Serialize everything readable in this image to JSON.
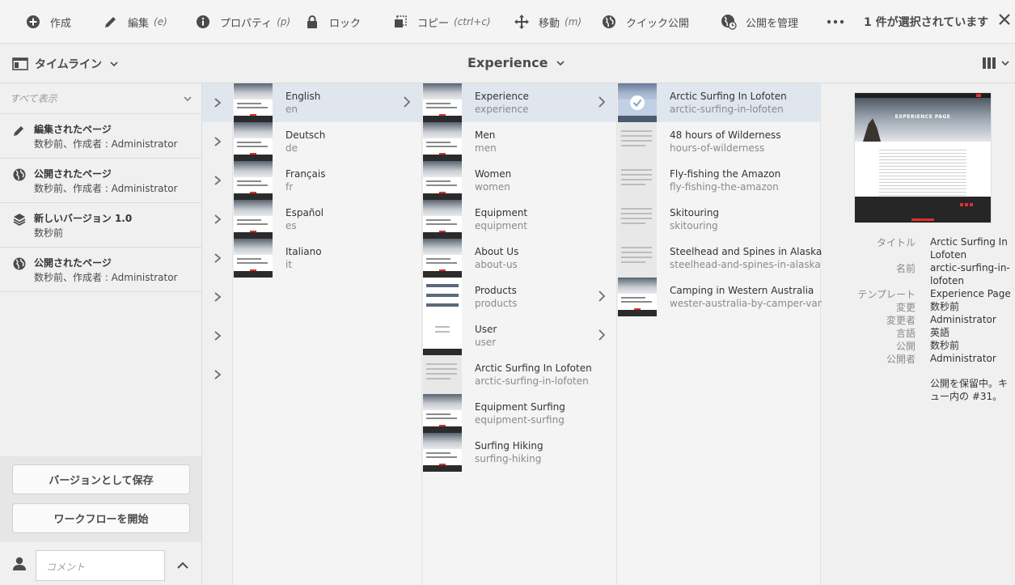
{
  "toolbar": {
    "create": "作成",
    "edit": "編集",
    "edit_shortcut": "(e)",
    "properties": "プロパティ",
    "properties_shortcut": "(p)",
    "lock": "ロック",
    "copy": "コピー",
    "copy_shortcut": "(ctrl+c)",
    "move": "移動",
    "move_shortcut": "(m)",
    "quick_publish": "クイック公開",
    "manage_publication": "公開を管理",
    "selection_count": "1 件が選択されています"
  },
  "subbar": {
    "rail_label": "タイムライン",
    "breadcrumb": "Experience"
  },
  "timeline": {
    "filter": "すべて表示",
    "items": [
      {
        "title": "編集されたページ",
        "sub": "数秒前、作成者 : Administrator",
        "icon": "pencil-icon"
      },
      {
        "title": "公開されたページ",
        "sub": "数秒前、作成者 : Administrator",
        "icon": "globe-icon"
      },
      {
        "title": "新しいバージョン 1.0",
        "sub": "数秒前",
        "icon": "layers-icon"
      },
      {
        "title": "公開されたページ",
        "sub": "数秒前、作成者 : Administrator",
        "icon": "globe-icon"
      }
    ],
    "save_version": "バージョンとして保存",
    "start_workflow": "ワークフローを開始",
    "comment_placeholder": "コメント"
  },
  "columns": {
    "languages": [
      {
        "title": "English",
        "name": "en"
      },
      {
        "title": "Deutsch",
        "name": "de"
      },
      {
        "title": "Français",
        "name": "fr"
      },
      {
        "title": "Español",
        "name": "es"
      },
      {
        "title": "Italiano",
        "name": "it"
      }
    ],
    "english": [
      {
        "title": "Experience",
        "name": "experience"
      },
      {
        "title": "Men",
        "name": "men"
      },
      {
        "title": "Women",
        "name": "women"
      },
      {
        "title": "Equipment",
        "name": "equipment"
      },
      {
        "title": "About Us",
        "name": "about-us"
      },
      {
        "title": "Products",
        "name": "products"
      },
      {
        "title": "User",
        "name": "user"
      },
      {
        "title": "Arctic Surfing In Lofoten",
        "name": "arctic-surfing-in-lofoten"
      },
      {
        "title": "Equipment Surfing",
        "name": "equipment-surfing"
      },
      {
        "title": "Surfing Hiking",
        "name": "surfing-hiking"
      }
    ],
    "experience": [
      {
        "title": "Arctic Surfing In Lofoten",
        "name": "arctic-surfing-in-lofoten"
      },
      {
        "title": "48 hours of Wilderness",
        "name": "hours-of-wilderness"
      },
      {
        "title": "Fly-fishing the Amazon",
        "name": "fly-fishing-the-amazon"
      },
      {
        "title": "Skitouring",
        "name": "skitouring"
      },
      {
        "title": "Steelhead and Spines in Alaska",
        "name": "steelhead-and-spines-in-alaska"
      },
      {
        "title": "Camping in Western Australia",
        "name": "wester-australia-by-camper-van"
      }
    ]
  },
  "preview": {
    "hero_text": "EXPERIENCE PAGE",
    "meta": [
      {
        "key": "タイトル",
        "value": "Arctic Surfing In Lofoten"
      },
      {
        "key": "名前",
        "value": "arctic-surfing-in-lofoten"
      },
      {
        "key": "テンプレート",
        "value": "Experience Page"
      },
      {
        "key": "変更",
        "value": "数秒前"
      },
      {
        "key": "変更者",
        "value": "Administrator"
      },
      {
        "key": "言語",
        "value": "英語"
      },
      {
        "key": "公開",
        "value": "数秒前"
      },
      {
        "key": "公開者",
        "value": "Administrator"
      }
    ],
    "pending_note": "公開を保留中。キュー内の #31。"
  }
}
